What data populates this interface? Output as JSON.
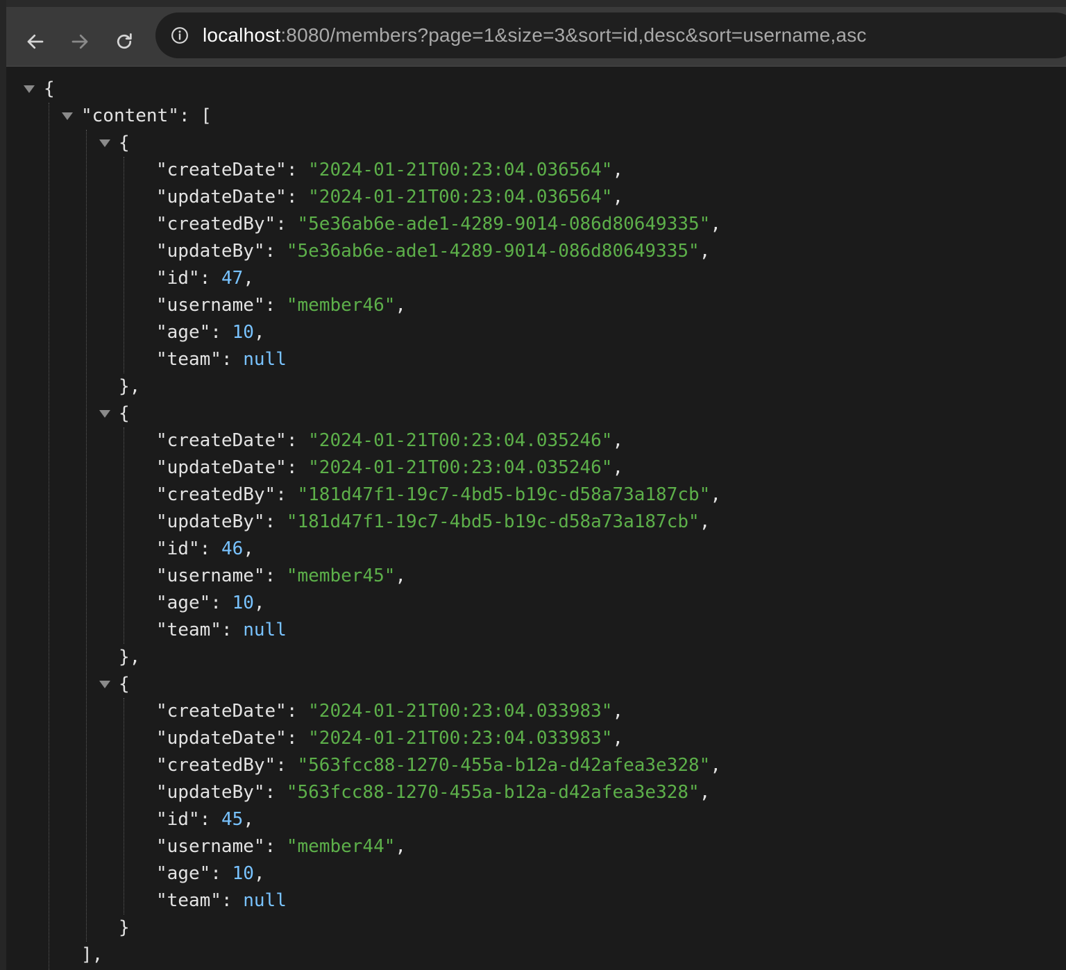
{
  "browser": {
    "url_host": "localhost",
    "url_rest": ":8080/members?page=1&size=3&sort=id,desc&sort=username,asc",
    "icons": [
      "back-arrow-icon",
      "forward-arrow-icon",
      "reload-icon",
      "info-icon"
    ]
  },
  "json_view": {
    "open_brace": "{",
    "content_key": "\"content\"",
    "colon": ": ",
    "open_bracket": "[",
    "close_bracket": "],",
    "items": [
      {
        "createDate": "\"2024-01-21T00:23:04.036564\"",
        "updateDate": "\"2024-01-21T00:23:04.036564\"",
        "createdBy": "\"5e36ab6e-ade1-4289-9014-086d80649335\"",
        "updateBy": "\"5e36ab6e-ade1-4289-9014-086d80649335\"",
        "id": "47",
        "username": "\"member46\"",
        "age": "10",
        "team": "null",
        "close": "},"
      },
      {
        "createDate": "\"2024-01-21T00:23:04.035246\"",
        "updateDate": "\"2024-01-21T00:23:04.035246\"",
        "createdBy": "\"181d47f1-19c7-4bd5-b19c-d58a73a187cb\"",
        "updateBy": "\"181d47f1-19c7-4bd5-b19c-d58a73a187cb\"",
        "id": "46",
        "username": "\"member45\"",
        "age": "10",
        "team": "null",
        "close": "},"
      },
      {
        "createDate": "\"2024-01-21T00:23:04.033983\"",
        "updateDate": "\"2024-01-21T00:23:04.033983\"",
        "createdBy": "\"563fcc88-1270-455a-b12a-d42afea3e328\"",
        "updateBy": "\"563fcc88-1270-455a-b12a-d42afea3e328\"",
        "id": "45",
        "username": "\"member44\"",
        "age": "10",
        "team": "null",
        "close": "}"
      }
    ],
    "keys": {
      "createDate": "\"createDate\"",
      "updateDate": "\"updateDate\"",
      "createdBy": "\"createdBy\"",
      "updateBy": "\"updateBy\"",
      "id": "\"id\"",
      "username": "\"username\"",
      "age": "\"age\"",
      "team": "\"team\""
    },
    "item_open": "{",
    "comma": ","
  },
  "colors": {
    "string": "#5db04a",
    "number": "#79c3ff",
    "text": "#e3e3e3",
    "background": "#1b1b1b"
  }
}
